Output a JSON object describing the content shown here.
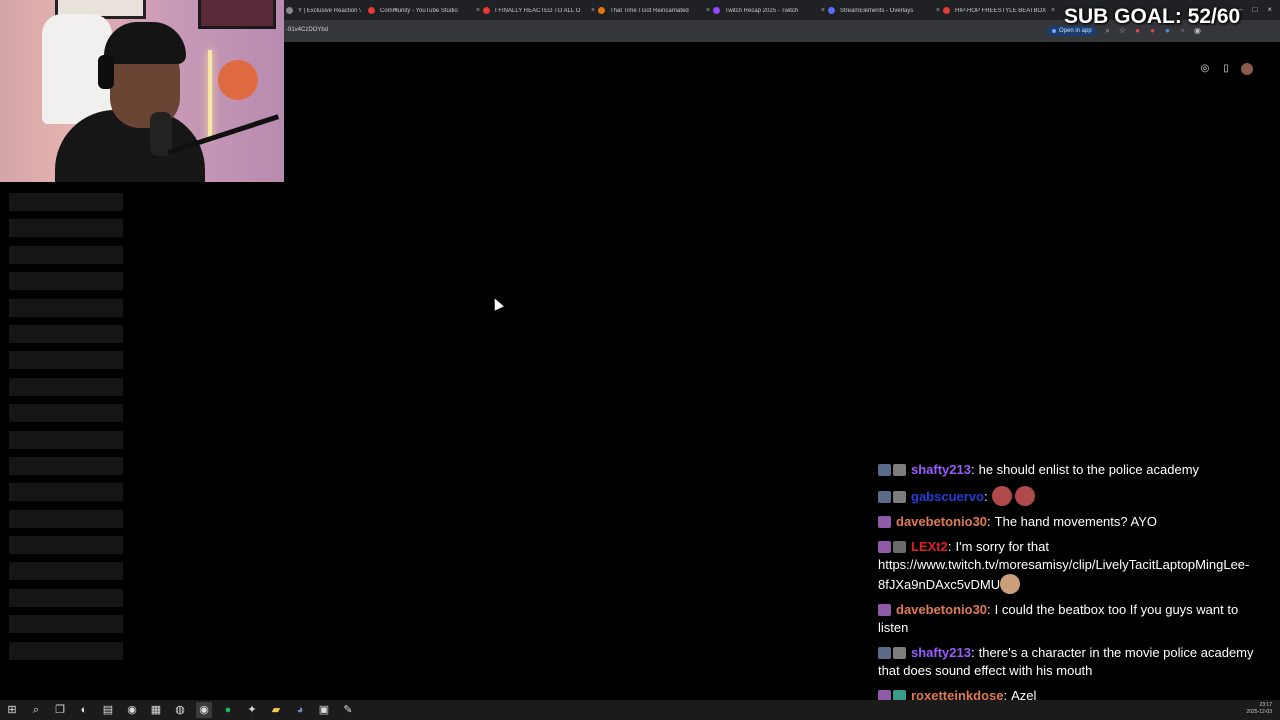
{
  "browser": {
    "tabs": [
      {
        "title": "Y | Exclusive Reaction \\",
        "icon_color": "#888888"
      },
      {
        "title": "Community - YouTube Studio",
        "icon_color": "#e53935"
      },
      {
        "title": "I FINALLY REACTED TO ALL O",
        "icon_color": "#e53935"
      },
      {
        "title": "That Time I Got Reincarnated",
        "icon_color": "#e8730c"
      },
      {
        "title": "Twitch Recap 2025 - Twitch",
        "icon_color": "#9146ff"
      },
      {
        "title": "StreamElements - Overlays",
        "icon_color": "#5b6cff"
      },
      {
        "title": "HIP-HOP FREESTYLE BEATBOX",
        "icon_color": "#e53935"
      }
    ],
    "url": "-91v4CzDOYbd",
    "open_in_app_label": "Open in app",
    "window_controls": [
      "–",
      "□",
      "×"
    ]
  },
  "stream_overlay": {
    "sub_goal": "SUB GOAL: 52/60"
  },
  "chat": [
    {
      "user": "shafty213",
      "user_color": "#9b5cff",
      "badges": [
        "#5a6b8a",
        "#7d7d7d"
      ],
      "text": "he should enlist to the police academy",
      "emotes": []
    },
    {
      "user": "gabscuervo",
      "user_color": "#1f3fd6",
      "badges": [
        "#5a6b8a",
        "#7d7d7d"
      ],
      "text": "",
      "emotes": [
        "#b04a4a",
        "#b04a4a"
      ]
    },
    {
      "user": "davebetonio30",
      "user_color": "#e07a52",
      "badges": [
        "#8f5aa8"
      ],
      "text": "The hand movements? AYO",
      "emotes": []
    },
    {
      "user": "LEXt2",
      "user_color": "#e02020",
      "badges": [
        "#8f5aa8",
        "#6b6b6b"
      ],
      "text": "I'm sorry for that https://www.twitch.tv/moresamisy/clip/LivelyTacitLaptopMingLee-8fJXa9nDAxc5vDMU",
      "emotes": [
        "#c9a07a"
      ]
    },
    {
      "user": "davebetonio30",
      "user_color": "#e07a52",
      "badges": [
        "#8f5aa8"
      ],
      "text": "I could the beatbox too If you guys want to listen",
      "emotes": []
    },
    {
      "user": "shafty213",
      "user_color": "#9b5cff",
      "badges": [
        "#5a6b8a",
        "#7d7d7d"
      ],
      "text": "there's a character in the movie police academy that does sound effect with his mouth",
      "emotes": []
    },
    {
      "user": "roxetteinkdose",
      "user_color": "#e07a52",
      "badges": [
        "#8f5aa8",
        "#3a9a8a"
      ],
      "text": "Azel",
      "emotes": []
    }
  ],
  "taskbar": {
    "icons": [
      "windows-start-icon",
      "search-icon",
      "task-view-icon",
      "edge-icon",
      "file-explorer-icon",
      "chrome-icon",
      "app-icon",
      "obs-icon",
      "chrome-active-icon",
      "spotify-icon",
      "app-icon-2",
      "sticky-notes-icon",
      "discord-icon",
      "app-icon-3",
      "app-icon-4"
    ],
    "time": "23:17",
    "date": "2025-12-03"
  }
}
